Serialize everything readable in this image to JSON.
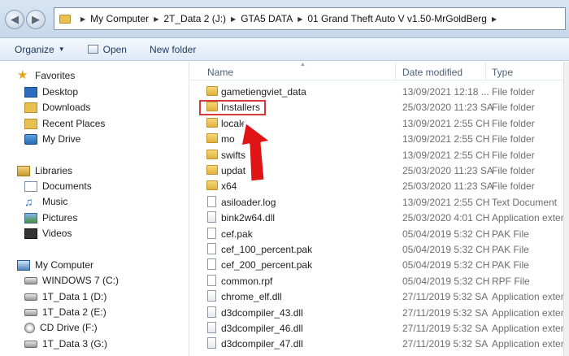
{
  "address_bar": {
    "breadcrumbs": [
      "My Computer",
      "2T_Data 2 (J:)",
      "GTA5 DATA",
      "01 Grand Theft Auto V v1.50-MrGoldBerg"
    ]
  },
  "toolbar": {
    "organize_label": "Organize",
    "open_label": "Open",
    "new_folder_label": "New folder"
  },
  "nav_pane": {
    "favorites_label": "Favorites",
    "favorites": [
      "Desktop",
      "Downloads",
      "Recent Places",
      "My Drive"
    ],
    "libraries_label": "Libraries",
    "libraries": [
      "Documents",
      "Music",
      "Pictures",
      "Videos"
    ],
    "computer_label": "My Computer",
    "drives": [
      "WINDOWS 7 (C:)",
      "1T_Data 1 (D:)",
      "1T_Data 2 (E:)",
      "CD Drive (F:)",
      "1T_Data 3 (G:)"
    ]
  },
  "columns": {
    "name": "Name",
    "date": "Date modified",
    "type": "Type"
  },
  "files": [
    {
      "name": "gametiengviet_data",
      "date": "13/09/2021 12:18 ...",
      "type": "File folder",
      "icon": "folder"
    },
    {
      "name": "Installers",
      "date": "25/03/2020 11:23 SA",
      "type": "File folder",
      "icon": "folder"
    },
    {
      "name": "locale",
      "date": "13/09/2021 2:55 CH",
      "type": "File folder",
      "icon": "folder"
    },
    {
      "name": "mo",
      "date": "13/09/2021 2:55 CH",
      "type": "File folder",
      "icon": "folder"
    },
    {
      "name": "swifts",
      "date": "13/09/2021 2:55 CH",
      "type": "File folder",
      "icon": "folder"
    },
    {
      "name": "updat",
      "date": "25/03/2020 11:23 SA",
      "type": "File folder",
      "icon": "folder"
    },
    {
      "name": "x64",
      "date": "25/03/2020 11:23 SA",
      "type": "File folder",
      "icon": "folder"
    },
    {
      "name": "asiloader.log",
      "date": "13/09/2021 2:55 CH",
      "type": "Text Document",
      "icon": "file"
    },
    {
      "name": "bink2w64.dll",
      "date": "25/03/2020 4:01 CH",
      "type": "Application extens...",
      "icon": "dll"
    },
    {
      "name": "cef.pak",
      "date": "05/04/2019 5:32 CH",
      "type": "PAK File",
      "icon": "file"
    },
    {
      "name": "cef_100_percent.pak",
      "date": "05/04/2019 5:32 CH",
      "type": "PAK File",
      "icon": "file"
    },
    {
      "name": "cef_200_percent.pak",
      "date": "05/04/2019 5:32 CH",
      "type": "PAK File",
      "icon": "file"
    },
    {
      "name": "common.rpf",
      "date": "05/04/2019 5:32 CH",
      "type": "RPF File",
      "icon": "file"
    },
    {
      "name": "chrome_elf.dll",
      "date": "27/11/2019 5:32 SA",
      "type": "Application extens...",
      "icon": "dll"
    },
    {
      "name": "d3dcompiler_43.dll",
      "date": "27/11/2019 5:32 SA",
      "type": "Application extens...",
      "icon": "dll"
    },
    {
      "name": "d3dcompiler_46.dll",
      "date": "27/11/2019 5:32 SA",
      "type": "Application extens...",
      "icon": "dll"
    },
    {
      "name": "d3dcompiler_47.dll",
      "date": "27/11/2019 5:32 SA",
      "type": "Application extens...",
      "icon": "dll"
    }
  ],
  "annotation": {
    "highlight_color": "#d63a3a",
    "arrow_color": "#e01414"
  }
}
